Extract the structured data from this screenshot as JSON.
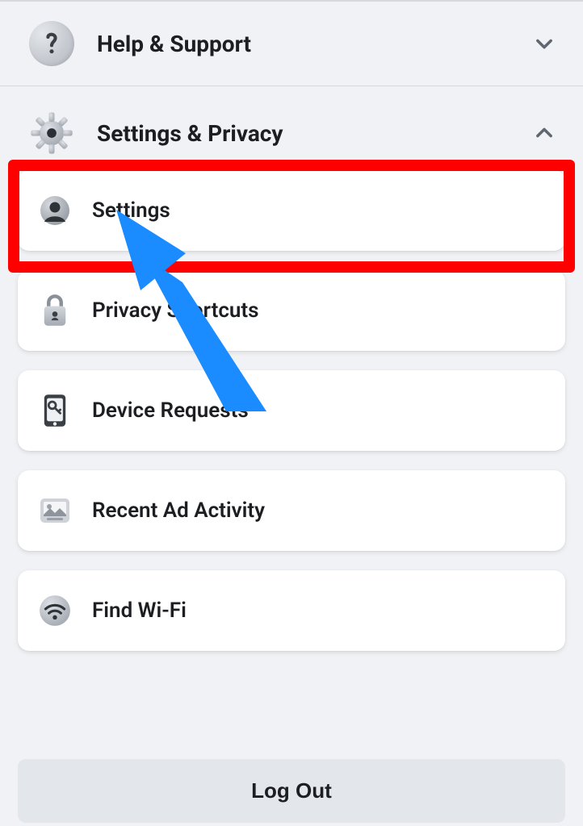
{
  "help_section": {
    "label": "Help & Support",
    "expanded": false
  },
  "settings_section": {
    "label": "Settings & Privacy",
    "expanded": true,
    "items": [
      {
        "label": "Settings",
        "icon": "user-silhouette-icon"
      },
      {
        "label": "Privacy Shortcuts",
        "icon": "lock-icon"
      },
      {
        "label": "Device Requests",
        "icon": "device-key-icon"
      },
      {
        "label": "Recent Ad Activity",
        "icon": "image-icon"
      },
      {
        "label": "Find Wi-Fi",
        "icon": "wifi-icon"
      }
    ]
  },
  "logout_label": "Log Out",
  "annotation": {
    "highlight_target": "Settings",
    "arrow_color": "#1a8cff",
    "highlight_color": "#ff0000"
  }
}
